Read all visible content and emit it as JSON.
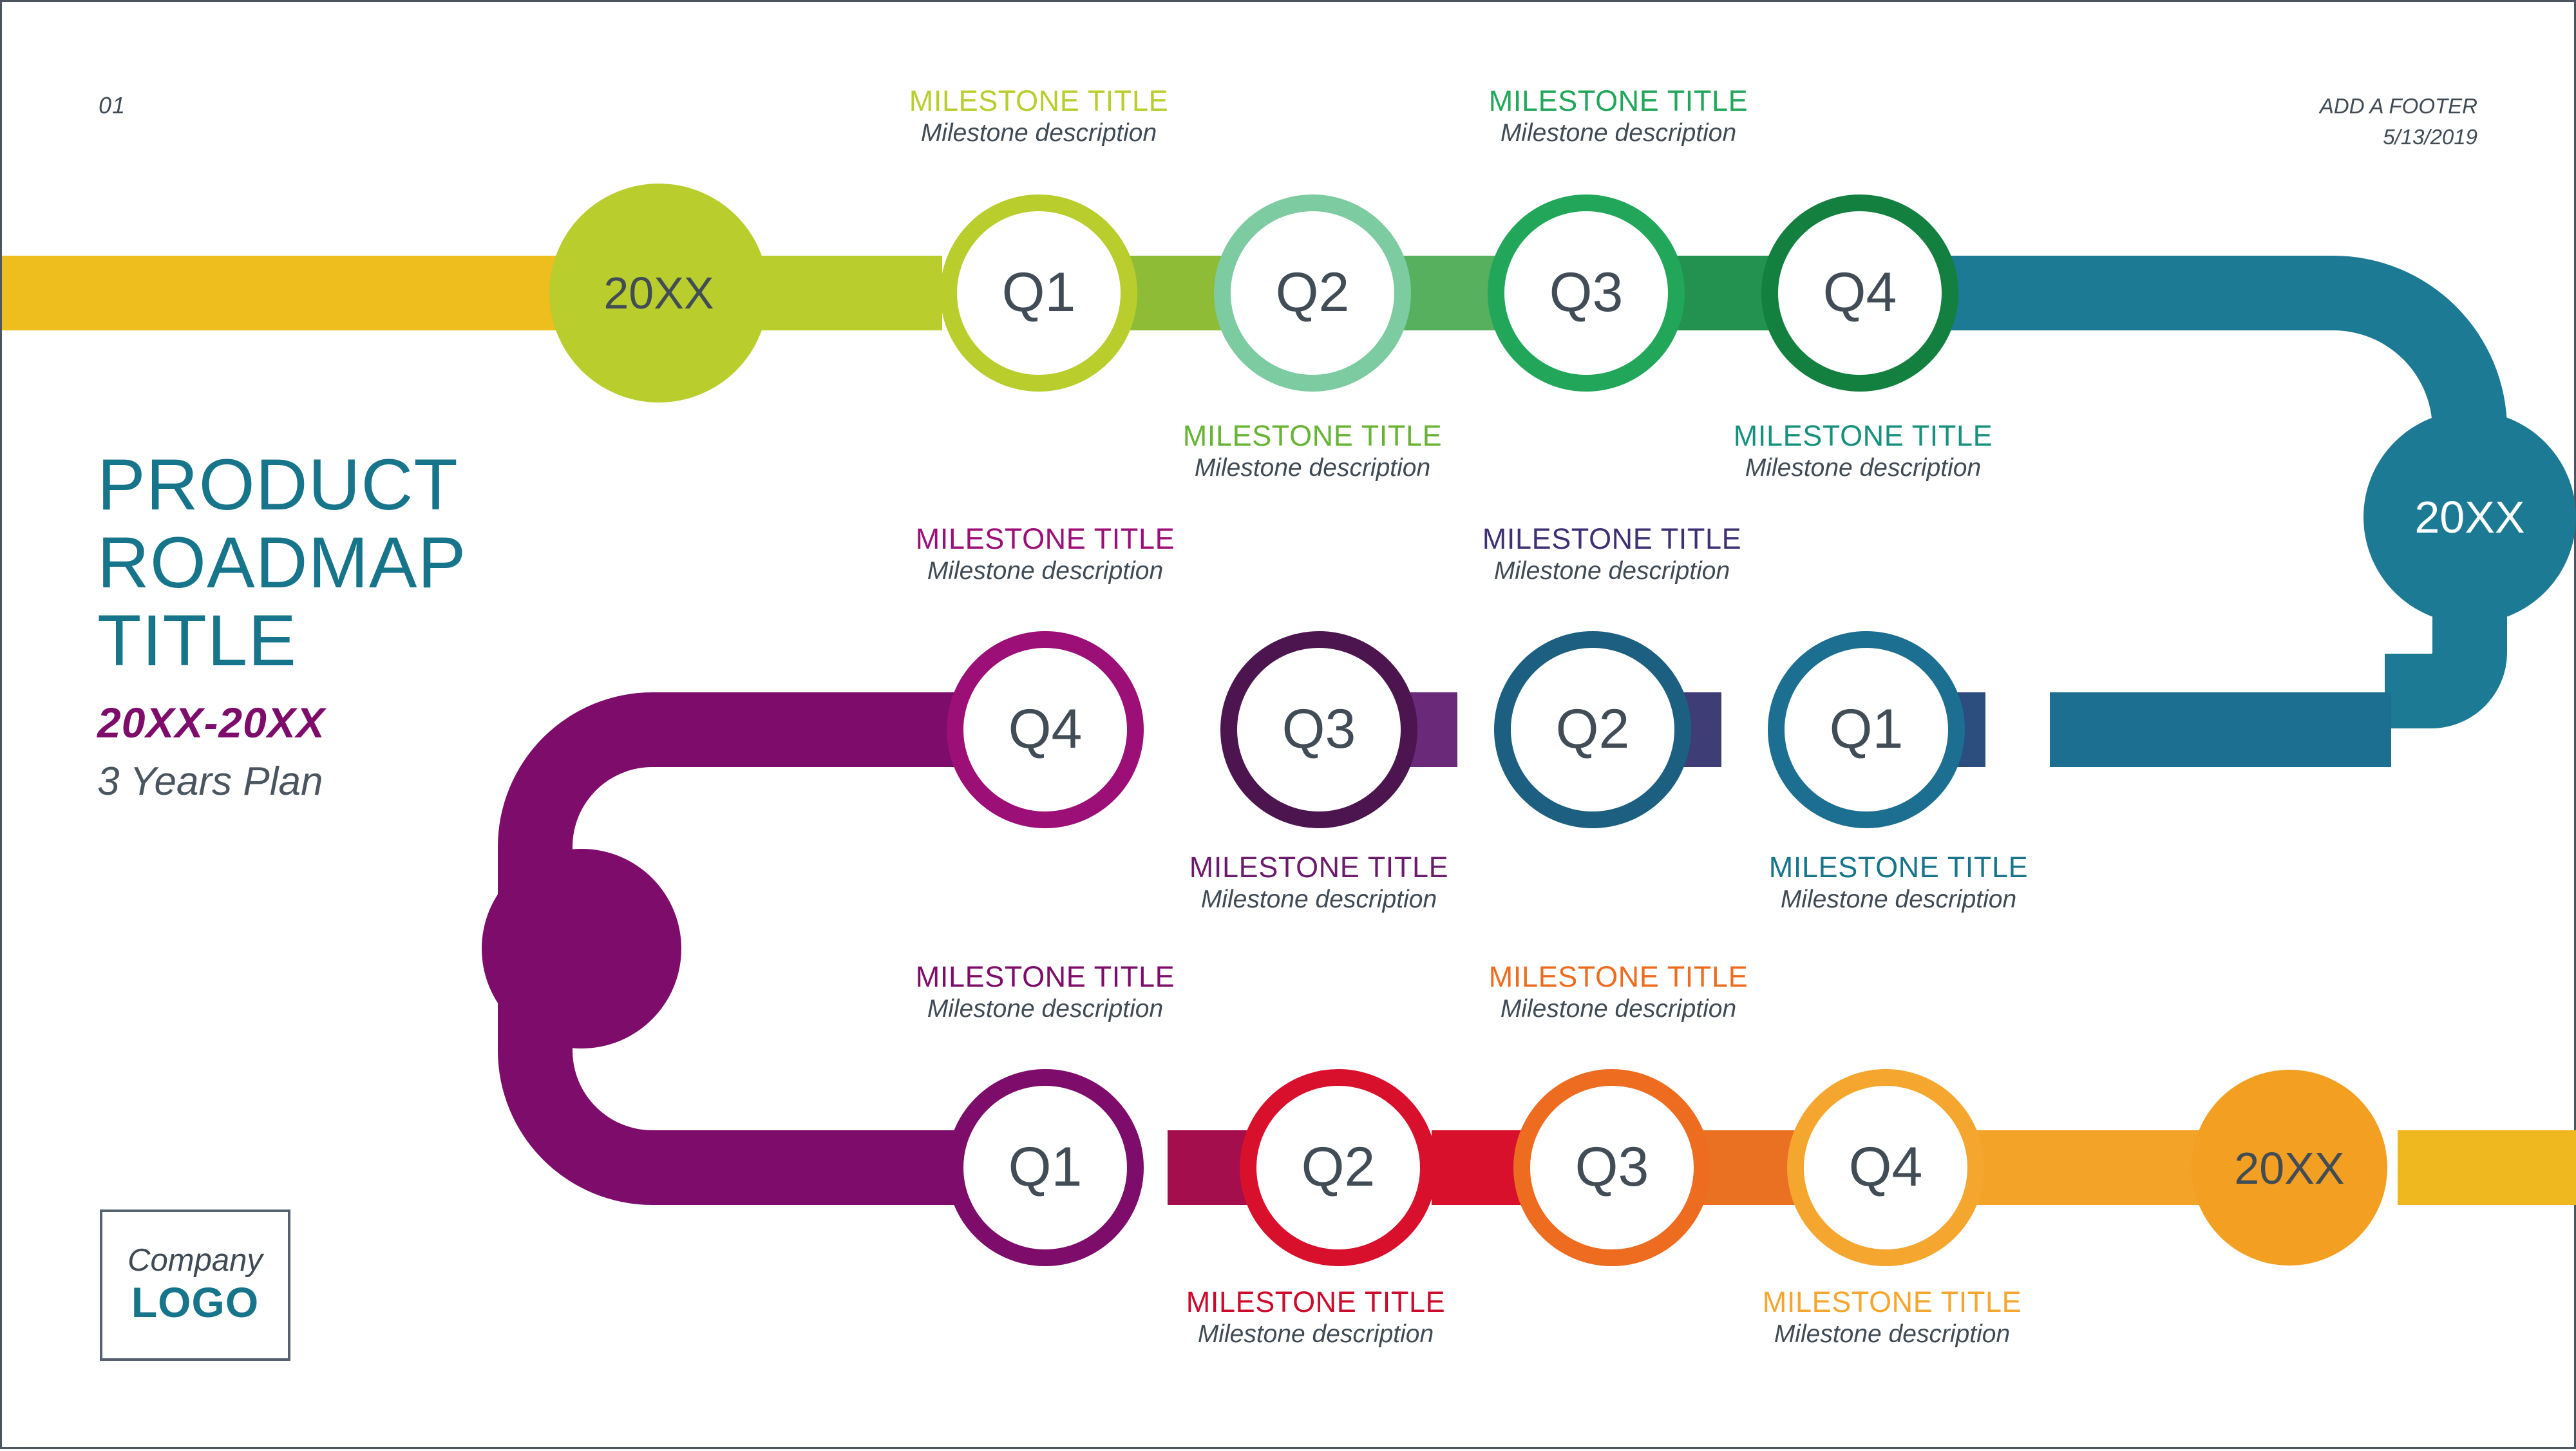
{
  "header": {
    "page_number": "01",
    "footer_text": "ADD A FOOTER",
    "date": "5/13/2019"
  },
  "title_block": {
    "line1": "PRODUCT",
    "line2": "ROADMAP",
    "line3": "TITLE",
    "year_range": "20XX-20XX",
    "subtitle": "3 Years Plan"
  },
  "logo": {
    "company_word": "Company",
    "logo_word": "LOGO"
  },
  "colors": {
    "title_teal": "#16748b",
    "range_purple": "#7d0c6b",
    "text_slate": "#3f4a54",
    "quarter_text": "#414c56",
    "track_yellow": "#edbe1e",
    "green_yellow": "#b9cd2d",
    "green_mid": "#67b334",
    "green_mint": "#7dcba0",
    "green": "#22a75a",
    "green_dark": "#14803f",
    "teal_green": "#17917e",
    "teal": "#16748b",
    "teal_deep": "#1d5f80",
    "indigo": "#3e3073",
    "purple_dark": "#4c1550",
    "purple": "#7d0c6b",
    "magenta": "#9c0f77",
    "red": "#d9102c",
    "red_dark": "#cc0a2b",
    "orange": "#ed6c1f",
    "amber": "#f5a62e",
    "amber_light": "#f6b12c"
  },
  "chart_data": {
    "type": "timeline",
    "title": "PRODUCT ROADMAP TITLE",
    "rows": [
      {
        "row": 1,
        "direction": "left-to-right",
        "start_node": {
          "label": "20XX",
          "fill": "#b9cd2d",
          "text_color": "#414c56"
        },
        "end_node": {
          "label": "20XX",
          "fill": "#1d7a94",
          "text_color": "#ffffff"
        },
        "nodes": [
          {
            "label": "Q1",
            "ring": "#b9cd2d",
            "title": "MILESTONE TITLE",
            "description": "Milestone description",
            "title_color": "#b9cd2d",
            "label_side": "above"
          },
          {
            "label": "Q2",
            "ring": "#7dcba0",
            "title": "MILESTONE TITLE",
            "description": "Milestone description",
            "title_color": "#67b334",
            "label_side": "below"
          },
          {
            "label": "Q3",
            "ring": "#22a75a",
            "title": "MILESTONE TITLE",
            "description": "Milestone description",
            "title_color": "#22a75a",
            "label_side": "above"
          },
          {
            "label": "Q4",
            "ring": "#14803f",
            "title": "MILESTONE TITLE",
            "description": "Milestone description",
            "title_color": "#17917e",
            "label_side": "below"
          }
        ]
      },
      {
        "row": 2,
        "direction": "right-to-left",
        "start_node": {
          "label": "",
          "fill": "#7d0c6b",
          "text_color": "#ffffff"
        },
        "nodes": [
          {
            "label": "Q4",
            "ring": "#9c0f77",
            "title": "MILESTONE TITLE",
            "description": "Milestone description",
            "title_color": "#9c0f77",
            "label_side": "above"
          },
          {
            "label": "Q3",
            "ring": "#4c1550",
            "title": "MILESTONE TITLE",
            "description": "Milestone description",
            "title_color": "#6b1b6b",
            "label_side": "below"
          },
          {
            "label": "Q2",
            "ring": "#1d5f80",
            "title": "MILESTONE TITLE",
            "description": "Milestone description",
            "title_color": "#3e3073",
            "label_side": "above"
          },
          {
            "label": "Q1",
            "ring": "#1d6f91",
            "title": "MILESTONE TITLE",
            "description": "Milestone description",
            "title_color": "#16748b",
            "label_side": "below"
          }
        ]
      },
      {
        "row": 3,
        "direction": "left-to-right",
        "end_node": {
          "label": "20XX",
          "fill": "#f29f22",
          "text_color": "#414c56"
        },
        "nodes": [
          {
            "label": "Q1",
            "ring": "#7d0c6b",
            "title": "MILESTONE TITLE",
            "description": "Milestone description",
            "title_color": "#7d0c6b",
            "label_side": "above"
          },
          {
            "label": "Q2",
            "ring": "#d9102c",
            "title": "MILESTONE TITLE",
            "description": "Milestone description",
            "title_color": "#cc0a2b",
            "label_side": "below"
          },
          {
            "label": "Q3",
            "ring": "#ed6c1f",
            "title": "MILESTONE TITLE",
            "description": "Milestone description",
            "title_color": "#ed6c1f",
            "label_side": "above"
          },
          {
            "label": "Q4",
            "ring": "#f5a62e",
            "title": "MILESTONE TITLE",
            "description": "Milestone description",
            "title_color": "#f5a62e",
            "label_side": "below"
          }
        ]
      }
    ]
  }
}
